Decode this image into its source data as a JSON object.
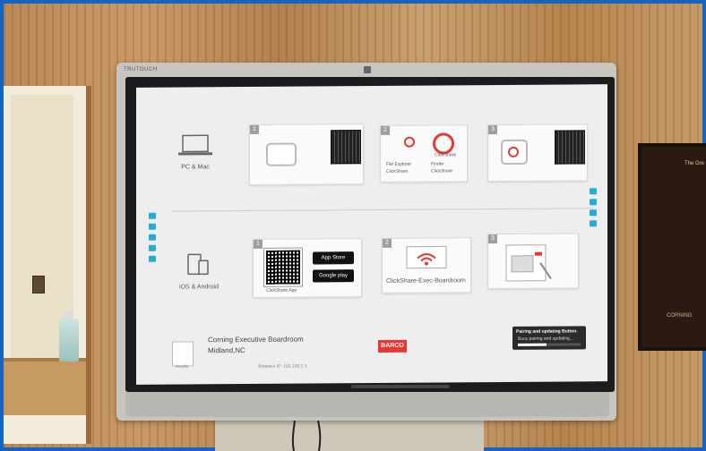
{
  "tv": {
    "brand": "TRUTOUCH",
    "brand_right": ""
  },
  "sections": {
    "pc": {
      "label": "PC & Mac"
    },
    "mobile": {
      "label": "iOS & Android"
    }
  },
  "steps": {
    "pc": [
      {
        "number": "1"
      },
      {
        "number": "2",
        "file_explorer": "File Explorer",
        "file_explorer_sub": "ClickShare",
        "finder": "Finder",
        "finder_sub": "ClickShare",
        "button_label": "ClickShare"
      },
      {
        "number": "3"
      }
    ],
    "mobile": [
      {
        "number": "1",
        "app_label": "ClickShare App",
        "app_store": "App Store",
        "google_play": "Google play"
      },
      {
        "number": "2",
        "network": "ClickShare-Exec-Boardroom"
      },
      {
        "number": "3"
      }
    ]
  },
  "footer": {
    "room_name": "Corning Executive Boardroom",
    "location": "Midland,NC",
    "ip": "Wireless IP: 192.168.2.1",
    "securify": "Securify",
    "logo": "BARCO"
  },
  "pairing": {
    "title": "Pairing and updating Button.",
    "subtitle": "Busy pairing and updating...",
    "progress": 0.45
  },
  "room": {
    "poster_text": "CORNING",
    "poster_top": "The Gre"
  }
}
